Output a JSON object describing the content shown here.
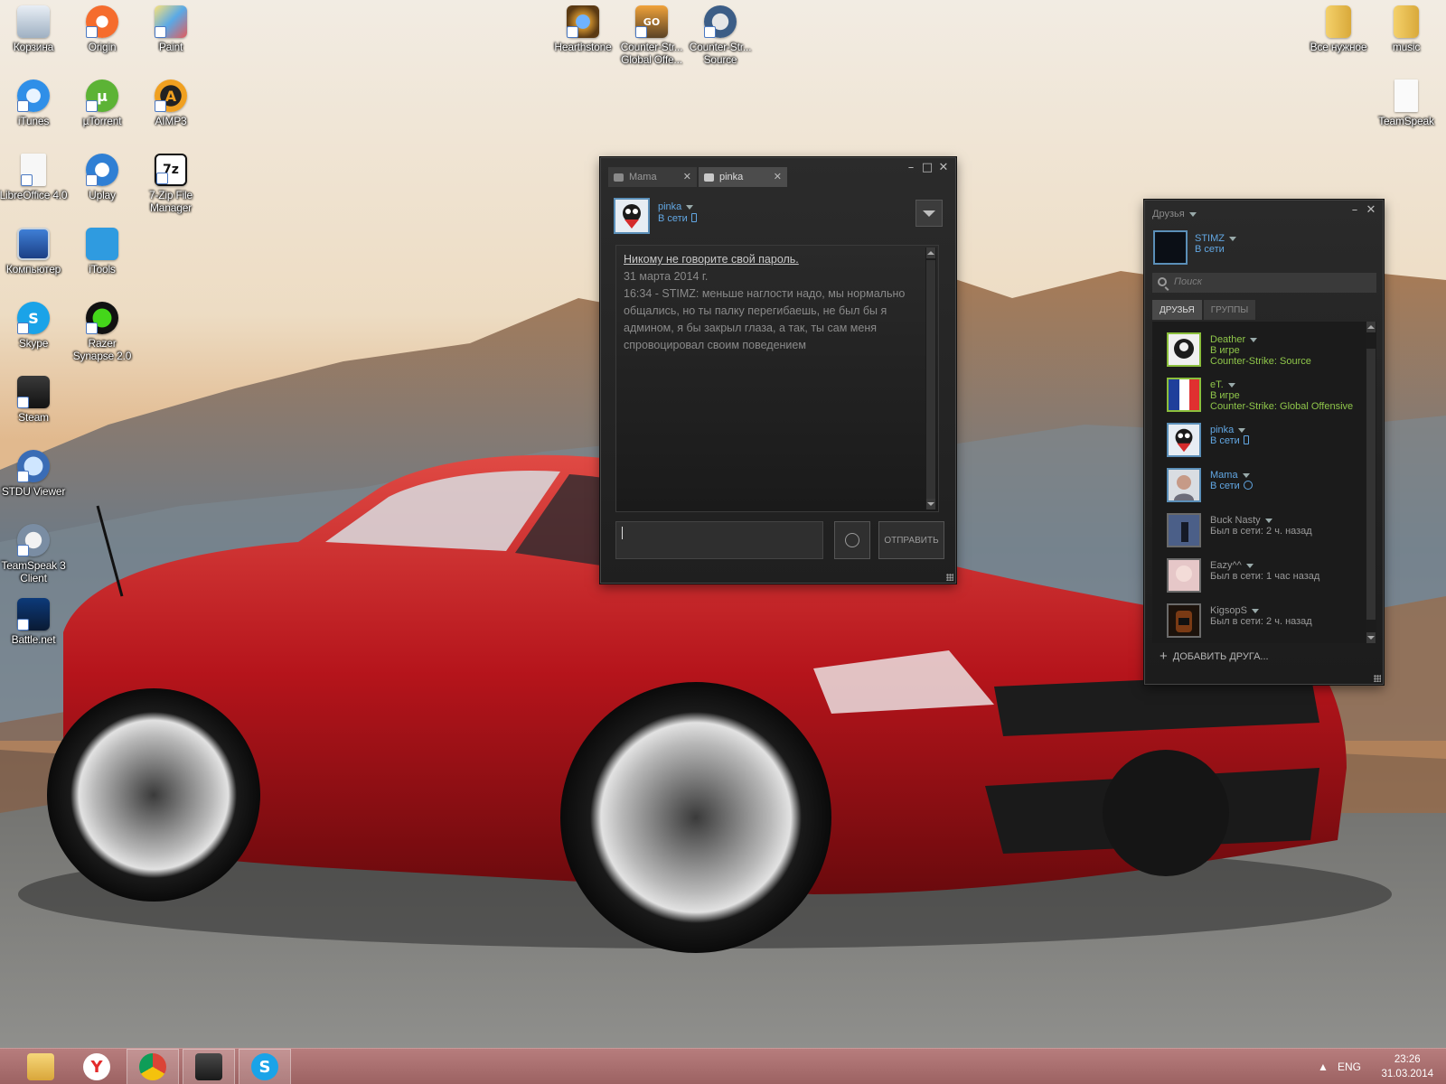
{
  "desktop": {
    "icons": [
      {
        "label": "Корзина",
        "icon": "recycle-bin-icon"
      },
      {
        "label": "Origin",
        "icon": "origin-icon"
      },
      {
        "label": "Paint",
        "icon": "paint-icon"
      },
      {
        "label": "Hearthstone",
        "icon": "hearthstone-icon"
      },
      {
        "label": "Counter-Str... Global Offe...",
        "icon": "csgo-icon"
      },
      {
        "label": "Counter-Str... Source",
        "icon": "css-icon"
      },
      {
        "label": "Все нужное",
        "icon": "folder-icon"
      },
      {
        "label": "music",
        "icon": "folder-icon"
      },
      {
        "label": "iTunes",
        "icon": "itunes-icon"
      },
      {
        "label": "µTorrent",
        "icon": "utorrent-icon"
      },
      {
        "label": "AIMP3",
        "icon": "aimp-icon"
      },
      {
        "label": "TeamSpeak",
        "icon": "document-icon"
      },
      {
        "label": "LibreOffice 4.0",
        "icon": "libreoffice-icon"
      },
      {
        "label": "Uplay",
        "icon": "uplay-icon"
      },
      {
        "label": "7-Zip File Manager",
        "icon": "7zip-icon"
      },
      {
        "label": "Компьютер",
        "icon": "computer-icon"
      },
      {
        "label": "iTools",
        "icon": "itools-icon"
      },
      {
        "label": "Skype",
        "icon": "skype-icon"
      },
      {
        "label": "Razer Synapse 2.0",
        "icon": "razer-icon"
      },
      {
        "label": "Steam",
        "icon": "steam-icon"
      },
      {
        "label": "STDU Viewer",
        "icon": "stdu-viewer-icon"
      },
      {
        "label": "TeamSpeak 3 Client",
        "icon": "teamspeak-icon"
      },
      {
        "label": "Battle.net",
        "icon": "battlenet-icon"
      }
    ]
  },
  "chat_window": {
    "tabs": [
      {
        "label": "Mama",
        "active": false
      },
      {
        "label": "pinka",
        "active": true
      }
    ],
    "contact": {
      "name": "pinka",
      "status": "В сети"
    },
    "messages": {
      "warning": "Никому не говорите свой пароль.",
      "date": "31 марта 2014 г.",
      "line": "16:34 - STIMZ: меньше наглости надо, мы нормально общались, но ты палку перегибаешь, не был бы я админом, я бы закрыл глаза, а так, ты сам меня спровоцировал своим поведением"
    },
    "send_label": "ОТПРАВИТЬ",
    "input_value": ""
  },
  "friends_window": {
    "title": "Друзья",
    "me": {
      "name": "STIMZ",
      "status": "В сети"
    },
    "search_placeholder": "Поиск",
    "tabs": [
      {
        "label": "ДРУЗЬЯ",
        "active": true
      },
      {
        "label": "ГРУППЫ",
        "active": false
      }
    ],
    "friends": [
      {
        "name": "Deather",
        "status": "В игре",
        "game": "Counter-Strike: Source",
        "state": "ingame"
      },
      {
        "name": "eT.",
        "status": "В игре",
        "game": "Counter-Strike: Global Offensive",
        "state": "ingame"
      },
      {
        "name": "pinka",
        "status": "В сети",
        "game": "",
        "state": "online"
      },
      {
        "name": "Mama",
        "status": "В сети",
        "game": "",
        "state": "online"
      },
      {
        "name": "Buck Nasty",
        "status": "Был в сети: 2 ч. назад",
        "game": "",
        "state": "offline"
      },
      {
        "name": "Eazy^^",
        "status": "Был в сети: 1 час назад",
        "game": "",
        "state": "offline"
      },
      {
        "name": "KigsopS",
        "status": "Был в сети: 2 ч. назад",
        "game": "",
        "state": "offline"
      }
    ],
    "add_friend_label": "ДОБАВИТЬ ДРУГА..."
  },
  "taskbar": {
    "pinned": [
      "file-explorer-icon",
      "yandex-browser-icon",
      "chrome-icon",
      "steam-icon",
      "skype-icon"
    ],
    "language": "ENG",
    "time": "23:26",
    "date": "31.03.2014"
  }
}
